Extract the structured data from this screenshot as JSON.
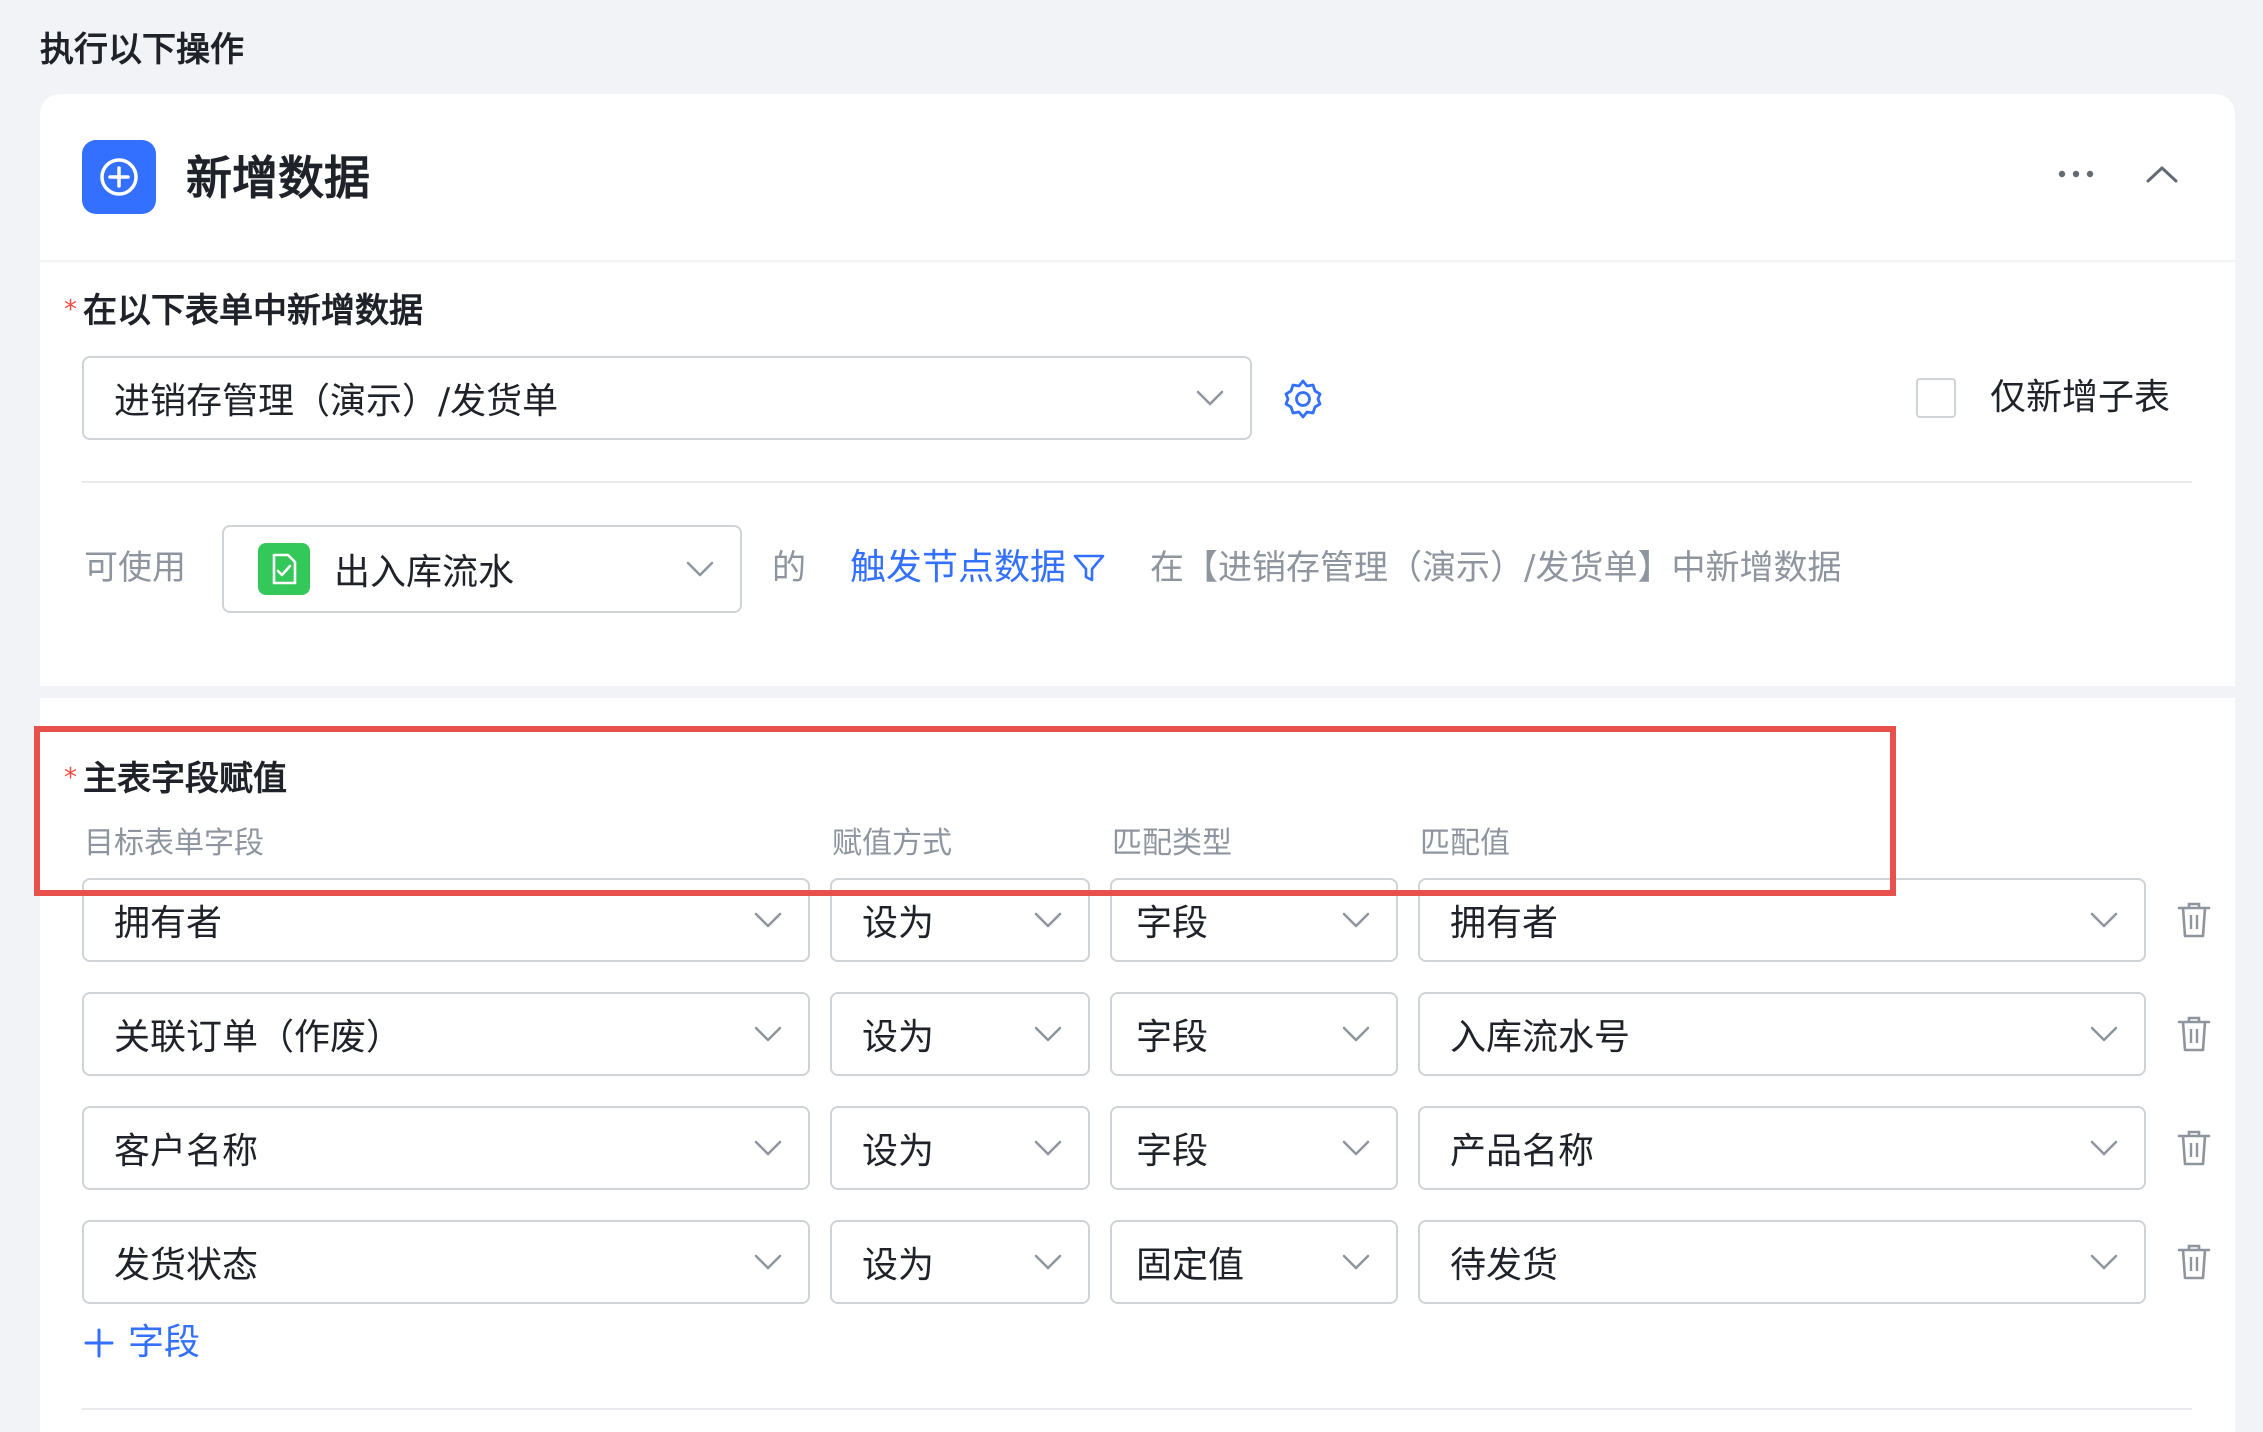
{
  "header": {
    "section_title": "执行以下操作",
    "card_title": "新增数据"
  },
  "target_form": {
    "label": "在以下表单中新增数据",
    "value": "进销存管理（演示）/发货单",
    "only_subtable_label": "仅新增子表"
  },
  "source": {
    "prefix": "可使用",
    "value": "出入库流水",
    "of": "的",
    "trigger_link": "触发节点数据",
    "suffix": "在【进销存管理（演示）/发货单】中新增数据"
  },
  "assign": {
    "label": "主表字段赋值",
    "columns": [
      "目标表单字段",
      "赋值方式",
      "匹配类型",
      "匹配值"
    ],
    "rows": [
      {
        "field": "拥有者",
        "method": "设为",
        "type": "字段",
        "value": "拥有者"
      },
      {
        "field": "关联订单（作废）",
        "method": "设为",
        "type": "字段",
        "value": "入库流水号"
      },
      {
        "field": "客户名称",
        "method": "设为",
        "type": "字段",
        "value": "产品名称"
      },
      {
        "field": "发货状态",
        "method": "设为",
        "type": "固定值",
        "value": "待发货"
      }
    ],
    "add_field": "字段"
  },
  "colors": {
    "accent": "#3370ff",
    "highlight": "#e8504c",
    "required": "#f54a45",
    "doc_icon": "#34c759"
  }
}
